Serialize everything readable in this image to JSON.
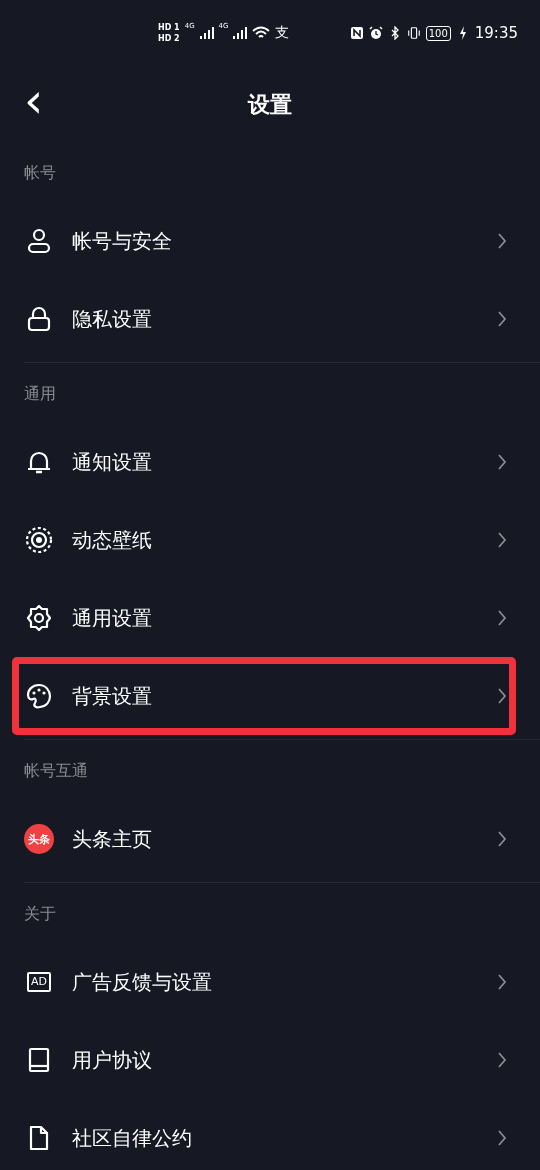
{
  "status_bar": {
    "sims": [
      "HD 1",
      "HD 2"
    ],
    "networks": [
      "4G",
      "4G"
    ],
    "notification": "支",
    "battery": "100",
    "time": "19:35"
  },
  "header": {
    "back": "‹",
    "title": "设置"
  },
  "sections": [
    {
      "label": "帐号",
      "items": [
        {
          "kind": "person",
          "label": "帐号与安全",
          "highlighted": false
        },
        {
          "kind": "lock",
          "label": "隐私设置",
          "highlighted": false
        }
      ]
    },
    {
      "label": "通用",
      "items": [
        {
          "kind": "bell",
          "label": "通知设置",
          "highlighted": false
        },
        {
          "kind": "wallpaper",
          "label": "动态壁纸",
          "highlighted": false
        },
        {
          "kind": "gear",
          "label": "通用设置",
          "highlighted": false
        },
        {
          "kind": "palette",
          "label": "背景设置",
          "highlighted": true
        }
      ]
    },
    {
      "label": "帐号互通",
      "items": [
        {
          "kind": "logo",
          "badge": "头条",
          "label": "头条主页",
          "highlighted": false
        }
      ]
    },
    {
      "label": "关于",
      "items": [
        {
          "kind": "ad",
          "badge": "AD",
          "label": "广告反馈与设置",
          "highlighted": false
        },
        {
          "kind": "book",
          "label": "用户协议",
          "highlighted": false
        },
        {
          "kind": "file",
          "label": "社区自律公约",
          "highlighted": false
        }
      ]
    }
  ]
}
